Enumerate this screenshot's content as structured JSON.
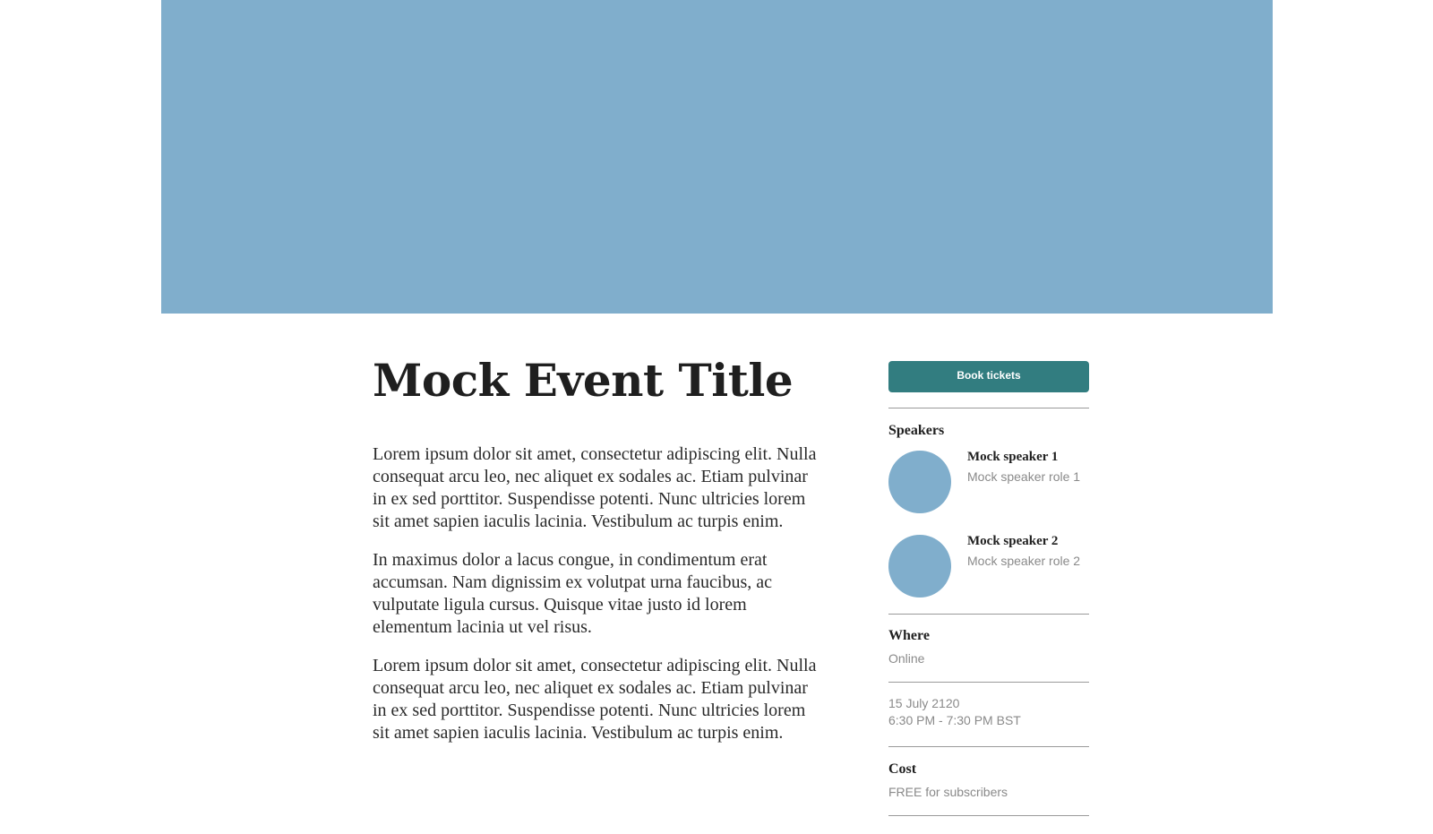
{
  "event": {
    "title": "Mock Event Title",
    "paragraphs": [
      "Lorem ipsum dolor sit amet, consectetur adipiscing elit. Nulla consequat arcu leo, nec aliquet ex sodales ac. Etiam pulvinar in ex sed porttitor. Suspendisse potenti. Nunc ultricies lorem sit amet sapien iaculis lacinia. Vestibulum ac turpis enim.",
      "In maximus dolor a lacus congue, in condimentum erat accumsan. Nam dignissim ex volutpat urna faucibus, ac vulputate ligula cursus. Quisque vitae justo id lorem elementum lacinia ut vel risus.",
      "Lorem ipsum dolor sit amet, consectetur adipiscing elit. Nulla consequat arcu leo, nec aliquet ex sodales ac. Etiam pulvinar in ex sed porttitor. Suspendisse potenti. Nunc ultricies lorem sit amet sapien iaculis lacinia. Vestibulum ac turpis enim."
    ]
  },
  "sidebar": {
    "book_button": "Book tickets",
    "speakers_heading": "Speakers",
    "speakers": [
      {
        "name": "Mock speaker 1",
        "role": "Mock speaker role 1"
      },
      {
        "name": "Mock speaker 2",
        "role": "Mock speaker role 2"
      }
    ],
    "where_heading": "Where",
    "where_value": "Online",
    "date": "15 July 2120",
    "time": "6:30 PM - 7:30 PM BST",
    "cost_heading": "Cost",
    "cost_value": "FREE for subscribers"
  },
  "colors": {
    "hero": "#80aecc",
    "avatar": "#80aecc",
    "button": "#327d80",
    "divider": "#9a9a9a",
    "muted_text": "#8a8a8a"
  }
}
